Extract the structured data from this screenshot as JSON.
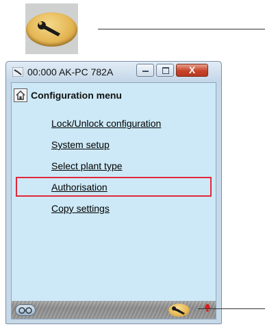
{
  "window": {
    "title": "00:000 AK-PC 782A",
    "close_glyph": "X"
  },
  "menu": {
    "header": "Configuration menu",
    "items": [
      "Lock/Unlock configuration",
      "System setup",
      "Select plant type",
      "Authorisation",
      "Copy settings"
    ],
    "highlighted_item": "Authorisation"
  },
  "colors": {
    "highlight_border": "#e0283a",
    "client_background": "#cde9f7",
    "alarm": "#e01a1a",
    "wrench_gold": "#e5b654"
  },
  "icons": {
    "callout": "wrench-badge-icon",
    "title": "app-icon",
    "header": "home-icon",
    "status_left": "glasses-icon",
    "status_right": "wrench-icon",
    "alarm": "alarm-bell-icon"
  }
}
